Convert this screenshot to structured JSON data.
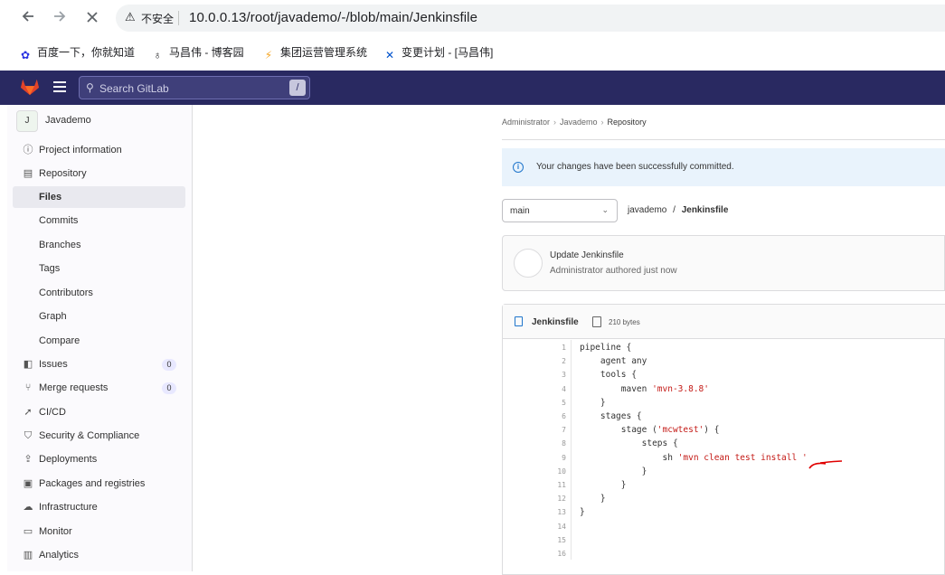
{
  "browser": {
    "back_icon": "arrow-left-icon",
    "forward_icon": "arrow-right-icon",
    "stop_icon": "close-icon",
    "security_label": "不安全",
    "url": "10.0.0.13/root/javademo/-/blob/main/Jenkinsfile",
    "bookmarks": [
      {
        "label": "百度一下，你就知道",
        "icon": "baidu-paw-icon",
        "color": "#2932e1"
      },
      {
        "label": "马昌伟 - 博客园",
        "icon": "cnblogs-icon",
        "color": "#333333"
      },
      {
        "label": "集团运营管理系统",
        "icon": "system-logo-icon",
        "color": "#f5a623"
      },
      {
        "label": "变更计划 - [马昌伟]",
        "icon": "confluence-icon",
        "color": "#0052cc"
      }
    ]
  },
  "header": {
    "search_placeholder": "Search GitLab",
    "search_shortcut": "/",
    "brand_color": "#292961"
  },
  "sidebar": {
    "project_initial": "J",
    "project_name": "Javademo",
    "items": [
      {
        "label": "Project information",
        "icon": "info-icon",
        "sub": false
      },
      {
        "label": "Repository",
        "icon": "document-icon",
        "sub": false
      },
      {
        "label": "Files",
        "icon": "",
        "sub": true,
        "active": true
      },
      {
        "label": "Commits",
        "icon": "",
        "sub": true
      },
      {
        "label": "Branches",
        "icon": "",
        "sub": true
      },
      {
        "label": "Tags",
        "icon": "",
        "sub": true
      },
      {
        "label": "Contributors",
        "icon": "",
        "sub": true
      },
      {
        "label": "Graph",
        "icon": "",
        "sub": true
      },
      {
        "label": "Compare",
        "icon": "",
        "sub": true
      },
      {
        "label": "Issues",
        "icon": "issues-icon",
        "sub": false,
        "badge": "0"
      },
      {
        "label": "Merge requests",
        "icon": "merge-request-icon",
        "sub": false,
        "badge": "0"
      },
      {
        "label": "CI/CD",
        "icon": "rocket-icon",
        "sub": false
      },
      {
        "label": "Security & Compliance",
        "icon": "shield-icon",
        "sub": false
      },
      {
        "label": "Deployments",
        "icon": "deployments-icon",
        "sub": false
      },
      {
        "label": "Packages and registries",
        "icon": "package-icon",
        "sub": false
      },
      {
        "label": "Infrastructure",
        "icon": "cloud-icon",
        "sub": false
      },
      {
        "label": "Monitor",
        "icon": "monitor-icon",
        "sub": false
      },
      {
        "label": "Analytics",
        "icon": "chart-icon",
        "sub": false
      }
    ]
  },
  "main": {
    "breadcrumb": [
      "Administrator",
      "Javademo",
      "Repository"
    ],
    "alert": "Your changes have been successfully committed.",
    "branch": "main",
    "path_project": "javademo",
    "path_sep": "/",
    "path_file": "Jenkinsfile",
    "commit_title": "Update Jenkinsfile",
    "commit_author": "Administrator",
    "commit_meta": "authored just now",
    "file_name": "Jenkinsfile",
    "file_size": "210 bytes",
    "code_lines": [
      {
        "n": "1",
        "segs": [
          {
            "t": "pipeline {",
            "c": ""
          }
        ]
      },
      {
        "n": "2",
        "segs": [
          {
            "t": "    agent any",
            "c": ""
          }
        ]
      },
      {
        "n": "3",
        "segs": [
          {
            "t": "    tools {",
            "c": ""
          }
        ]
      },
      {
        "n": "4",
        "segs": [
          {
            "t": "        maven ",
            "c": ""
          },
          {
            "t": "'mvn-3.8.8'",
            "c": "str"
          }
        ]
      },
      {
        "n": "5",
        "segs": [
          {
            "t": "    }",
            "c": ""
          }
        ]
      },
      {
        "n": "6",
        "segs": [
          {
            "t": "    stages {",
            "c": ""
          }
        ]
      },
      {
        "n": "7",
        "segs": [
          {
            "t": "        stage (",
            "c": ""
          },
          {
            "t": "'mcwtest'",
            "c": "str"
          },
          {
            "t": ") {",
            "c": ""
          }
        ]
      },
      {
        "n": "8",
        "segs": [
          {
            "t": "            steps {",
            "c": ""
          }
        ]
      },
      {
        "n": "9",
        "segs": [
          {
            "t": "                sh ",
            "c": ""
          },
          {
            "t": "'mvn clean test install '",
            "c": "str"
          }
        ]
      },
      {
        "n": "10",
        "segs": [
          {
            "t": "            }",
            "c": ""
          }
        ]
      },
      {
        "n": "11",
        "segs": [
          {
            "t": "        }",
            "c": ""
          }
        ]
      },
      {
        "n": "12",
        "segs": [
          {
            "t": "    }",
            "c": ""
          }
        ]
      },
      {
        "n": "13",
        "segs": [
          {
            "t": "}",
            "c": ""
          }
        ]
      },
      {
        "n": "14",
        "segs": []
      },
      {
        "n": "15",
        "segs": []
      },
      {
        "n": "16",
        "segs": []
      }
    ]
  }
}
